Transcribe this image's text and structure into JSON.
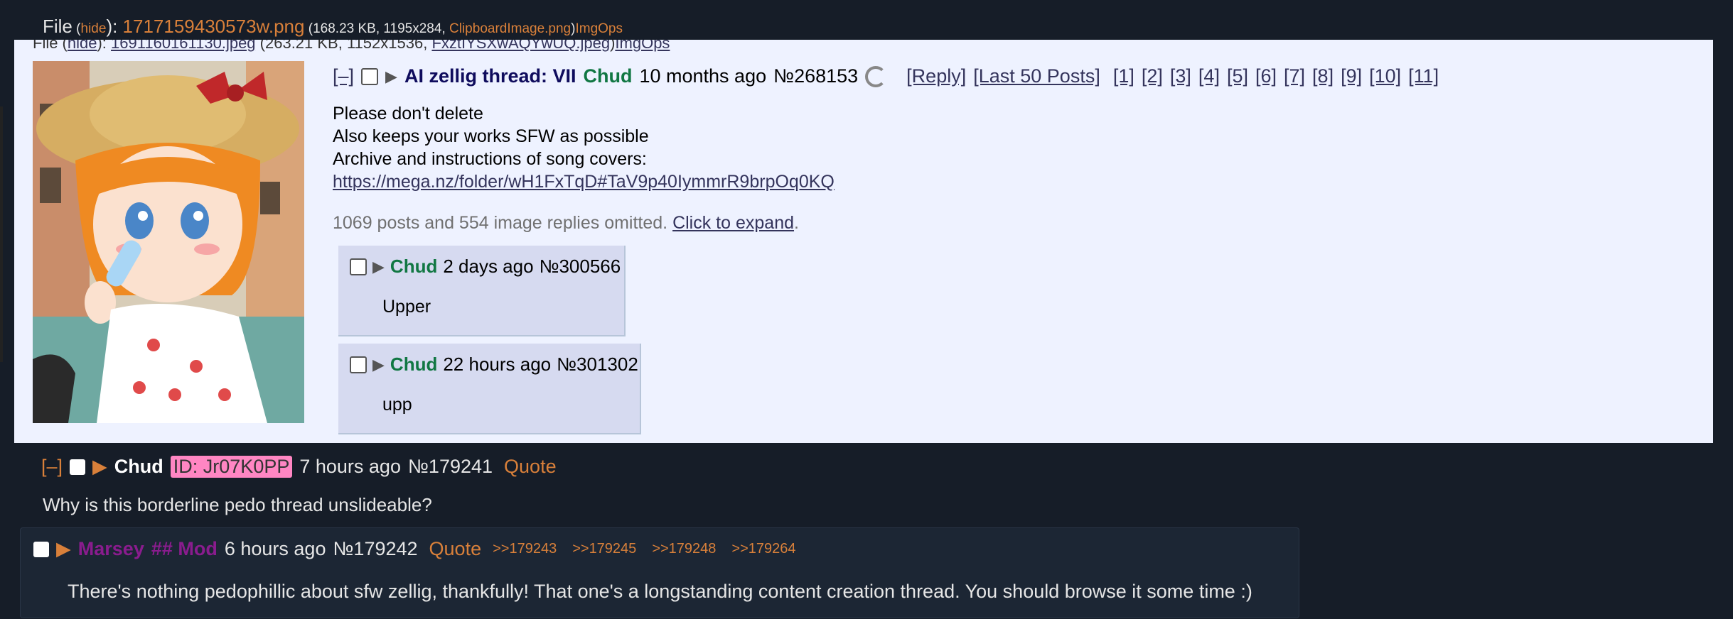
{
  "top_file": {
    "label": "File",
    "open": " (",
    "hide": "hide",
    "close": "): ",
    "filename": "1717159430573w.png",
    "meta": " (168.23 KB, 1195x284, ",
    "orig_name": "ClipboardImage.png",
    "meta_end": ")",
    "imgops": "ImgOps"
  },
  "embedded": {
    "cut_file": {
      "label": "File (",
      "hide": "hide",
      "sep": "): ",
      "filename": "1691160161130.jpeg",
      "meta": " (263.21 KB, 1152x1536, ",
      "orig": "FxztIYSXwAQYwUQ.jpeg",
      "end": ")",
      "imgops": "ImgOps"
    },
    "thread": {
      "collapse": "[–]",
      "subject": "AI zellig thread: VII",
      "name": "Chud",
      "time": "10 months ago",
      "number": "№268153",
      "reply": "[Reply]",
      "last50": "[Last 50 Posts]",
      "pages": [
        "[1]",
        "[2]",
        "[3]",
        "[4]",
        "[5]",
        "[6]",
        "[7]",
        "[8]",
        "[9]",
        "[10]",
        "[11]"
      ],
      "body": [
        "Please don't delete",
        "Also keeps your works SFW as possible",
        "Archive and instructions of song covers:"
      ],
      "link": "https://mega.nz/folder/wH1FxTqD#TaV9p40IymmrR9brpOq0KQ",
      "omitted": "1069 posts and 554 image replies omitted. ",
      "expand": "Click to expand",
      "dot": "."
    },
    "replies": [
      {
        "name": "Chud",
        "time": "2 days ago",
        "number": "№300566",
        "body": "Upper"
      },
      {
        "name": "Chud",
        "time": "22 hours ago",
        "number": "№301302",
        "body": "upp"
      }
    ]
  },
  "post1": {
    "collapse": "[–]",
    "name": "Chud",
    "id": "ID: Jr07K0PP",
    "time": "7 hours ago",
    "number": "№179241",
    "quote": "Quote",
    "body": "Why is this borderline pedo thread unslideable?"
  },
  "post2": {
    "name": "Marsey",
    "cap": "## Mod",
    "time": "6 hours ago",
    "number": "№179242",
    "quote": "Quote",
    "backlinks": [
      ">>179243",
      ">>179245",
      ">>179248",
      ">>179264"
    ],
    "body": "There's nothing pedophillic about sfw zellig, thankfully! That one's a longstanding content creation thread. You should browse it some time :)"
  },
  "colors": {
    "background": "#161d28",
    "embedded_bg": "#eef2ff",
    "reply_bg": "#d6daf0",
    "accent_orange": "#d9803a",
    "name_green": "#117743",
    "mod_purple": "#8a1c8e",
    "id_pink": "#ff86c3"
  }
}
